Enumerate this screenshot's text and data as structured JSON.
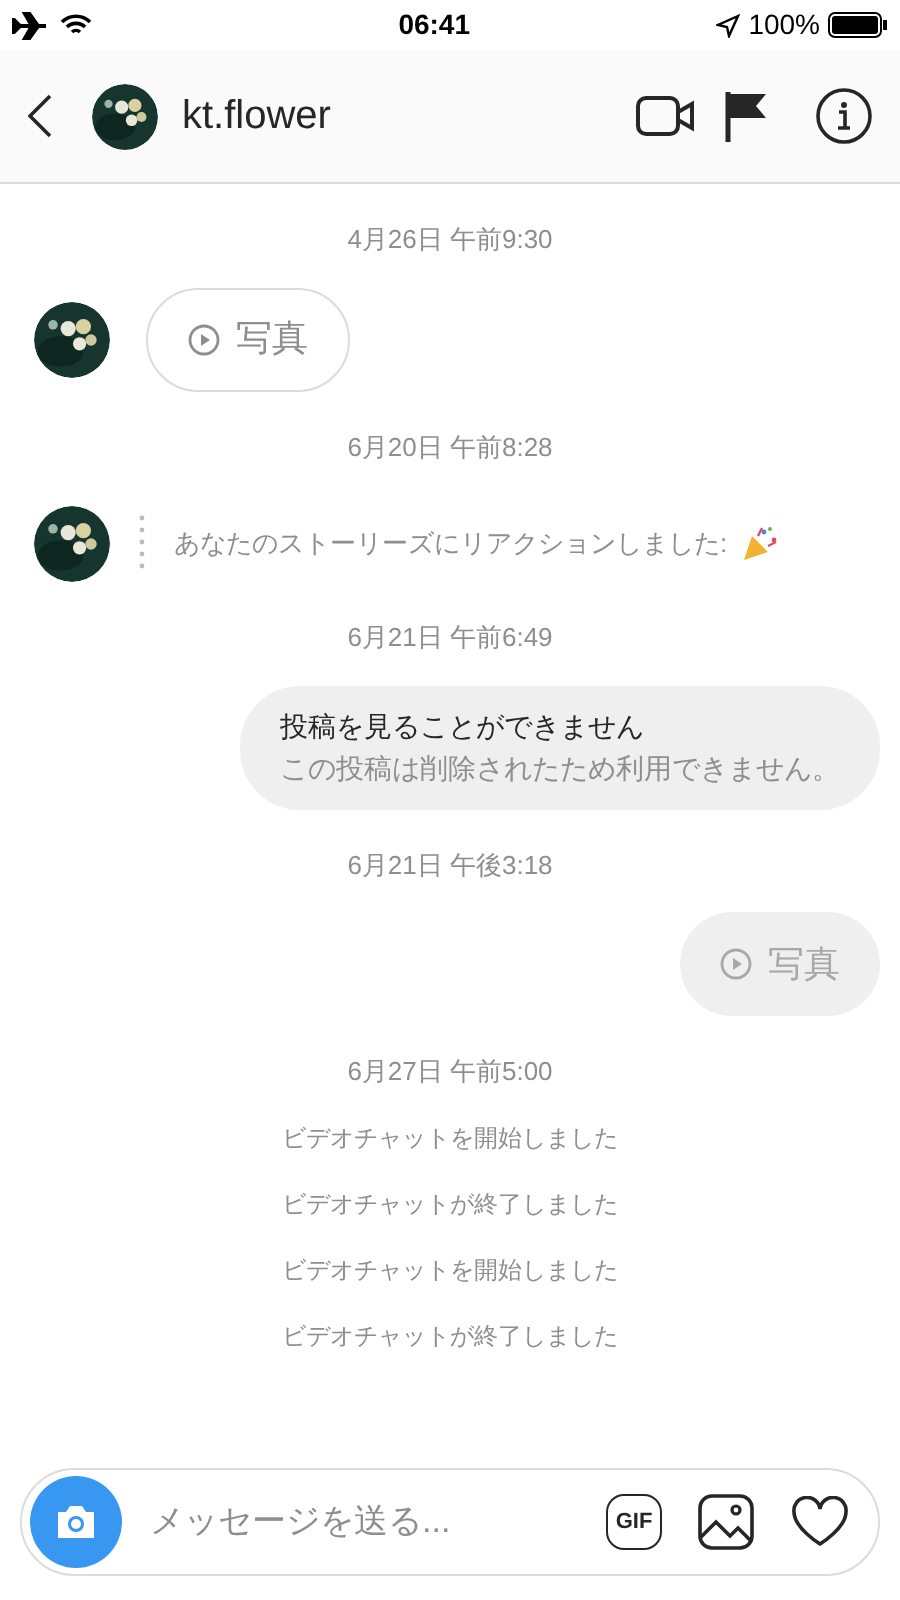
{
  "status_bar": {
    "time": "06:41",
    "battery": "100%"
  },
  "header": {
    "username": "kt.flower"
  },
  "messages": [
    {
      "kind": "timestamp",
      "text": "4月26日 午前9:30"
    },
    {
      "kind": "incoming_media",
      "text": "写真"
    },
    {
      "kind": "timestamp",
      "text": "6月20日 午前8:28"
    },
    {
      "kind": "incoming_reaction",
      "text": "あなたのストーリーズにリアクションしました:"
    },
    {
      "kind": "timestamp",
      "text": "6月21日 午前6:49"
    },
    {
      "kind": "outgoing_notice",
      "title": "投稿を見ることができません",
      "text": "この投稿は削除されたため利用できません。"
    },
    {
      "kind": "timestamp",
      "text": "6月21日 午後3:18"
    },
    {
      "kind": "outgoing_media",
      "text": "写真"
    },
    {
      "kind": "timestamp",
      "text": "6月27日 午前5:00"
    },
    {
      "kind": "system",
      "text": "ビデオチャットを開始しました"
    },
    {
      "kind": "system",
      "text": "ビデオチャットが終了しました"
    },
    {
      "kind": "system",
      "text": "ビデオチャットを開始しました"
    },
    {
      "kind": "system",
      "text": "ビデオチャットが終了しました"
    }
  ],
  "composer": {
    "placeholder": "メッセージを送る...",
    "gif_label": "GIF"
  }
}
